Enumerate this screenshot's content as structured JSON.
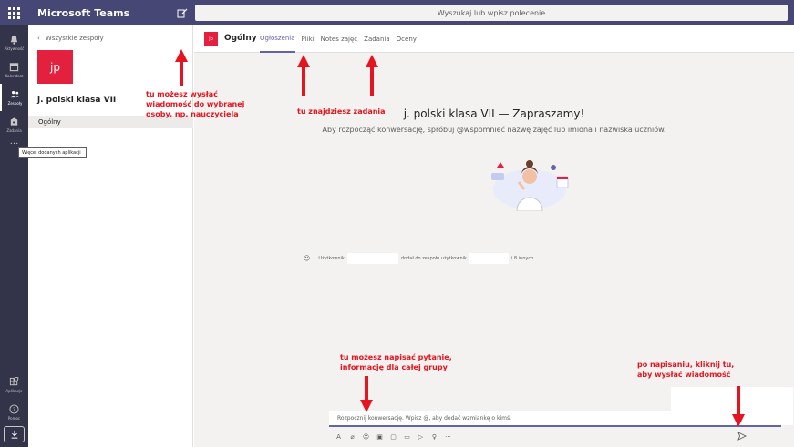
{
  "app": {
    "title": "Microsoft Teams",
    "search_placeholder": "Wyszukaj lub wpisz polecenie"
  },
  "rail": {
    "items": [
      {
        "label": "Aktywność",
        "icon": "bell-icon"
      },
      {
        "label": "Kalendarz",
        "icon": "calendar-icon"
      },
      {
        "label": "Zespoły",
        "icon": "teams-icon"
      },
      {
        "label": "Zadania",
        "icon": "assignments-icon"
      }
    ],
    "more": "···",
    "tooltip": "Więcej dodanych aplikacji",
    "bottom": [
      {
        "label": "Aplikacje",
        "icon": "apps-icon"
      },
      {
        "label": "Pomoc",
        "icon": "help-icon"
      }
    ]
  },
  "team": {
    "back": "Wszystkie zespoły",
    "avatar": "jp",
    "name": "j. polski klasa VII",
    "channel": "Ogólny"
  },
  "channel": {
    "avatar": "jp",
    "name": "Ogólny",
    "tabs": [
      "Ogłoszenia",
      "Pliki",
      "Notes zajęć",
      "Zadania",
      "Oceny"
    ],
    "active_tab": 0
  },
  "welcome": {
    "title": "j. polski klasa VII — Zapraszamy!",
    "subtitle": "Aby rozpocząć konwersację, spróbuj @wspomnieć nazwę zajęć lub imiona i nazwiska uczniów."
  },
  "system_message": {
    "part1": "Użytkownik",
    "part2": "dodał do zespołu użytkownik",
    "part3": "i 8 innych."
  },
  "compose": {
    "placeholder": "Rozpocznij konwersację. Wpisz @, aby dodać wzmiankę o kimś."
  },
  "annotations": {
    "compose_hint": [
      "tu możesz wysłać",
      "wiadomość do wybranej",
      "osoby, np. nauczyciela"
    ],
    "tasks_hint": "tu znajdziesz zadania",
    "question_hint": [
      "tu możesz napisać pytanie,",
      "informację dla całej grupy"
    ],
    "send_hint": [
      "po napisaniu, kliknij tu,",
      "aby wysłać wiadomość"
    ]
  },
  "colors": {
    "accent": "#6264a7",
    "topbar": "#464775",
    "rail": "#33344a",
    "team": "#e3203d",
    "annotation": "#e6141e"
  }
}
